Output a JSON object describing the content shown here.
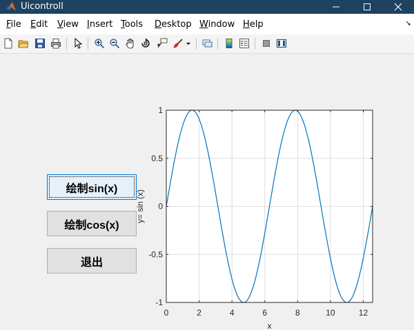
{
  "window": {
    "title": "Uicontroll"
  },
  "menu": [
    {
      "key": "F",
      "rest": "ile"
    },
    {
      "key": "E",
      "rest": "dit"
    },
    {
      "key": "V",
      "rest": "iew"
    },
    {
      "key": "I",
      "rest": "nsert"
    },
    {
      "key": "T",
      "rest": "ools"
    },
    {
      "key": "D",
      "rest": "esktop"
    },
    {
      "key": "W",
      "rest": "indow"
    },
    {
      "key": "H",
      "rest": "elp"
    }
  ],
  "toolbar": [
    "new-figure-icon",
    "open-file-icon",
    "save-icon",
    "print-icon",
    "pointer-icon",
    "zoom-in-icon",
    "zoom-out-icon",
    "pan-icon",
    "rotate-3d-icon",
    "data-cursor-icon",
    "brush-icon",
    "link-plot-icon",
    "insert-colorbar-icon",
    "insert-legend-icon",
    "hide-plot-tools-icon",
    "show-plot-tools-icon"
  ],
  "buttons": {
    "sin": "绘制sin(x)",
    "cos": "绘制cos(x)",
    "exit": "退出"
  },
  "chart_data": {
    "type": "line",
    "function": "y = sin(x)",
    "xlabel": "x",
    "ylabel": "y= sin (x)",
    "xlim": [
      0,
      12.566
    ],
    "ylim": [
      -1,
      1
    ],
    "xticks": [
      0,
      2,
      4,
      6,
      8,
      10,
      12
    ],
    "yticks": [
      1,
      0.5,
      0,
      -0.5,
      -1
    ],
    "ytick_labels": [
      "1",
      "0.5",
      "0",
      "-0.5",
      "-1"
    ],
    "grid": true,
    "color": "#0072bd",
    "series": [
      {
        "x": [
          0,
          0.785,
          1.571,
          2.356,
          3.142,
          3.927,
          4.712,
          5.498,
          6.283,
          7.069,
          7.854,
          8.639,
          9.425,
          10.21,
          10.996,
          11.781,
          12.566
        ],
        "y": [
          0,
          0.707,
          1,
          0.707,
          0,
          -0.707,
          -1,
          -0.707,
          0,
          0.707,
          1,
          0.707,
          0,
          -0.707,
          -1,
          -0.707,
          0
        ]
      }
    ]
  }
}
